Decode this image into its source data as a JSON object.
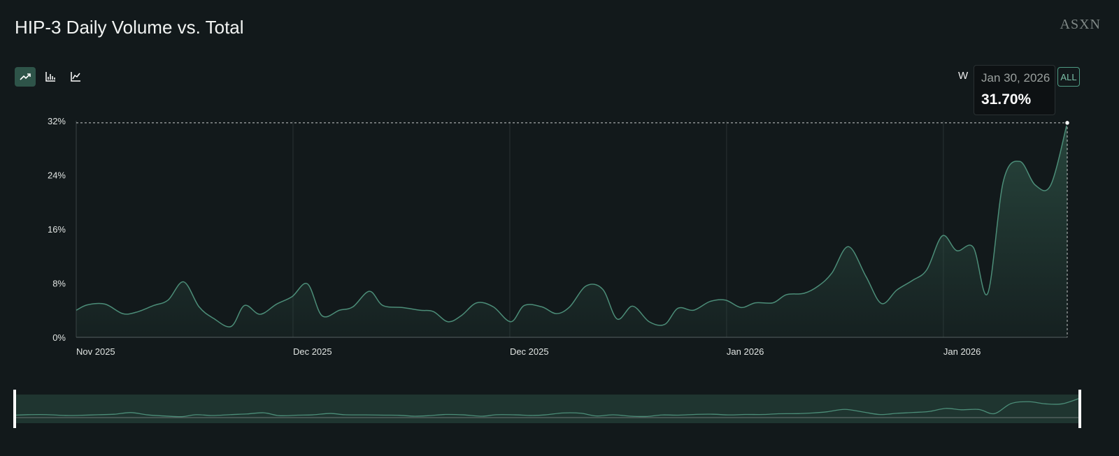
{
  "title": "HIP-3 Daily Volume vs. Total",
  "logo": "ASXN",
  "toolbar": {
    "icons": [
      "area-chart-icon",
      "bar-chart-icon",
      "line-chart-icon"
    ],
    "range_partial": "W",
    "range_all": "ALL"
  },
  "tooltip": {
    "date": "Jan 30, 2026",
    "value": "31.70%"
  },
  "colors": {
    "line": "#4c8d78",
    "fill": "#2a4a40",
    "accent": "#4f9b83"
  },
  "chart_data": {
    "type": "area",
    "title": "HIP-3 Daily Volume vs. Total",
    "xlabel": "",
    "ylabel": "",
    "ylim": [
      0,
      32
    ],
    "xlim": [
      0,
      96
    ],
    "yticks": [
      0,
      8,
      16,
      24,
      32
    ],
    "ytick_labels": [
      "0%",
      "8%",
      "16%",
      "24%",
      "32%"
    ],
    "xticks": [
      0,
      21,
      42,
      63,
      84
    ],
    "xtick_labels": [
      "Nov 2025",
      "Dec 2025",
      "Dec 2025",
      "Jan 2026",
      "Jan 2026"
    ],
    "grid": "vertical",
    "x": [
      0,
      1.1,
      2.8,
      4.5,
      5.8,
      7.5,
      8.9,
      10.4,
      11.9,
      13.3,
      15,
      16.3,
      17.8,
      19.4,
      20.9,
      22.4,
      23.8,
      25.5,
      26.8,
      28.4,
      29.7,
      31.6,
      33.3,
      34.6,
      36,
      37.3,
      38.8,
      40.4,
      42.1,
      43.4,
      45.1,
      46.5,
      47.8,
      49.4,
      51,
      52.4,
      53.9,
      55.5,
      57,
      58.3,
      59.8,
      61.4,
      62.9,
      64.4,
      65.8,
      67.5,
      68.8,
      70.5,
      71.9,
      73.2,
      74.8,
      76.5,
      78,
      79.5,
      81,
      82.4,
      83.9,
      85.3,
      86.9,
      88.3,
      89.8,
      91.4,
      92.9,
      94.4,
      96
    ],
    "values": [
      4.0,
      4.8,
      4.9,
      3.5,
      3.7,
      4.7,
      5.5,
      8.2,
      4.5,
      2.8,
      1.6,
      4.7,
      3.4,
      4.9,
      6.0,
      7.9,
      3.2,
      4.0,
      4.5,
      6.8,
      4.7,
      4.4,
      4.0,
      3.8,
      2.3,
      3.2,
      5.1,
      4.5,
      2.3,
      4.7,
      4.5,
      3.5,
      4.5,
      7.6,
      7.1,
      2.7,
      4.6,
      2.3,
      1.9,
      4.3,
      4.0,
      5.3,
      5.5,
      4.4,
      5.1,
      5.1,
      6.3,
      6.5,
      7.6,
      9.5,
      13.4,
      9.0,
      5.0,
      7.0,
      8.4,
      10.0,
      15.0,
      12.8,
      13.3,
      6.5,
      23.0,
      26.0,
      22.5,
      22.5,
      31.7
    ]
  }
}
